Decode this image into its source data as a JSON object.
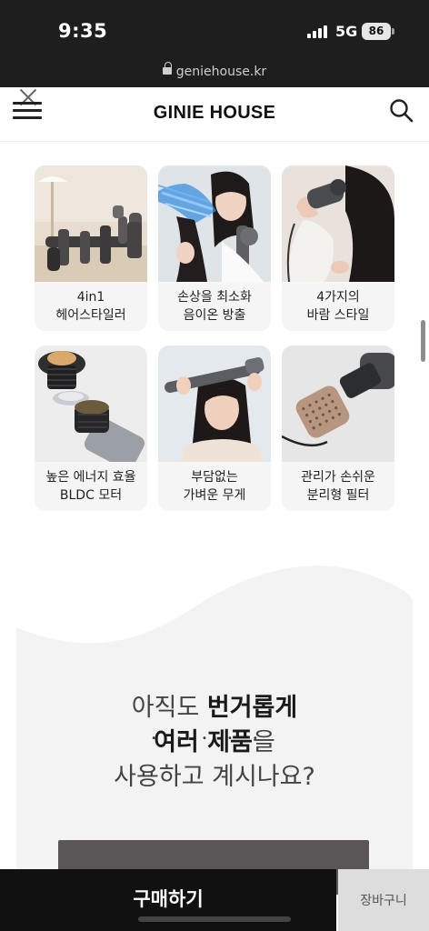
{
  "status_bar": {
    "time": "9:35",
    "network": "5G",
    "battery": "86"
  },
  "browser": {
    "url": "geniehouse.kr"
  },
  "header": {
    "brand": "GINIE HOUSE"
  },
  "features": [
    {
      "line1": "4in1",
      "line2": "헤어스타일러"
    },
    {
      "line1": "손상을 최소화",
      "line2": "음이온 방출"
    },
    {
      "line1": "4가지의",
      "line2": "바람 스타일"
    },
    {
      "line1": "높은 에너지 효율",
      "line2": "BLDC 모터"
    },
    {
      "line1": "부담없는",
      "line2": "가벼운 무게"
    },
    {
      "line1": "관리가 손쉬운",
      "line2": "분리형 필터"
    }
  ],
  "headline": {
    "line1_prefix": "아직도 ",
    "line1_strong": "번거롭게",
    "line2_strong": "여러 제품",
    "line2_suffix": "을",
    "line3": "사용하고 계시나요?"
  },
  "bottom": {
    "buy_label": "구매하기",
    "cart_label": "장바구니"
  }
}
